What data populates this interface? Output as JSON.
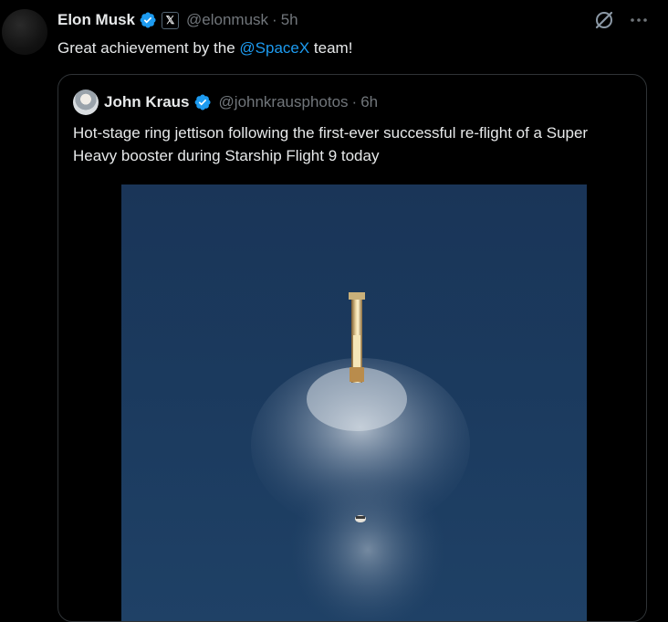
{
  "tweet": {
    "author_name": "Elon Musk",
    "author_handle": "@elonmusk",
    "separator": "·",
    "time": "5h",
    "affiliation_badge": "𝕏",
    "text_before": "Great achievement by the ",
    "mention": "@SpaceX",
    "text_after": " team!",
    "icons": [
      "verified-badge-icon",
      "x-affiliation-icon",
      "grok-icon",
      "more-icon"
    ]
  },
  "quote": {
    "author_name": "John Kraus",
    "author_handle": "@johnkrausphotos",
    "separator": "·",
    "time": "6h",
    "text": "Hot-stage ring jettison following the first-ever successful re-flight of a Super Heavy booster during Starship Flight 9 today",
    "icons": [
      "verified-badge-icon"
    ]
  },
  "colors": {
    "background": "#000000",
    "text_primary": "#e7e9ea",
    "text_secondary": "#71767b",
    "accent": "#1d9bf0",
    "border": "#2f3336",
    "sky": "#1b3a5e"
  }
}
